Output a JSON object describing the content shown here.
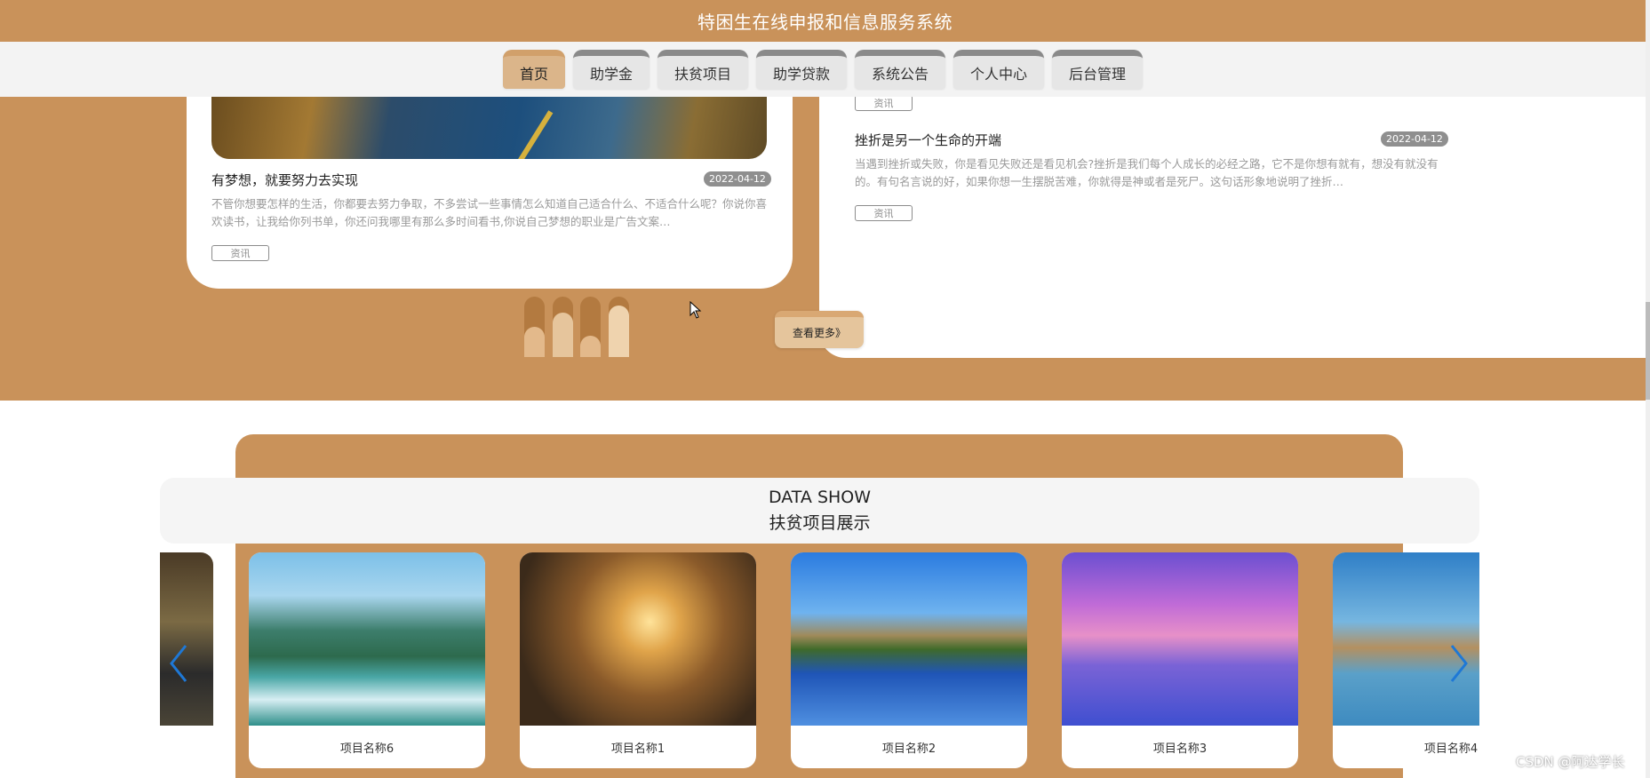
{
  "header": {
    "title": "特困生在线申报和信息服务系统"
  },
  "nav": {
    "items": [
      {
        "label": "首页",
        "active": true
      },
      {
        "label": "助学金"
      },
      {
        "label": "扶贫项目"
      },
      {
        "label": "助学贷款"
      },
      {
        "label": "系统公告"
      },
      {
        "label": "个人中心"
      },
      {
        "label": "后台管理"
      }
    ]
  },
  "news": {
    "left": {
      "title": "有梦想，就要努力去实现",
      "date": "2022-04-12",
      "text": "不管你想要怎样的生活，你都要去努力争取，不多尝试一些事情怎么知道自己适合什么、不适合什么呢？你说你喜欢读书，让我给你列书单，你还问我哪里有那么多时间看书,你说自己梦想的职业是广告文案…",
      "tag": "资讯"
    },
    "right_top_tag": "资讯",
    "right": {
      "title": "挫折是另一个生命的开端",
      "date": "2022-04-12",
      "text": "当遇到挫折或失败，你是看见失败还是看见机会?挫折是我们每个人成长的必经之路，它不是你想有就有，想没有就没有的。有句名言说的好，如果你想一生摆脱苦难，你就得是神或者是死尸。这句话形象地说明了挫折…",
      "tag": "资讯"
    },
    "more_label": "查看更多》"
  },
  "show": {
    "title_en": "DATA SHOW",
    "title_zh": "扶贫项目展示",
    "cards": [
      {
        "name": "项目名称6"
      },
      {
        "name": "项目名称1"
      },
      {
        "name": "项目名称2"
      },
      {
        "name": "项目名称3"
      },
      {
        "name": "项目名称4"
      }
    ]
  },
  "watermark": "CSDN @阿达学长",
  "colors": {
    "primary": "#c9925a",
    "nav_active": "#dbb58a",
    "arrow": "#1e78d6"
  }
}
